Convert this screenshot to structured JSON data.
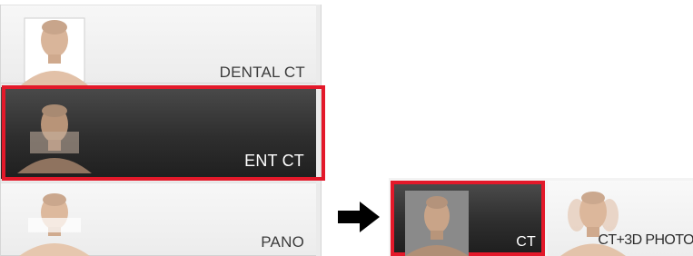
{
  "mode_list": {
    "items": [
      {
        "label": "DENTAL CT",
        "thumbnail_icon": "head-portrait-icon",
        "selected": false
      },
      {
        "label": "ENT CT",
        "thumbnail_icon": "head-portrait-icon",
        "selected": true
      },
      {
        "label": "PANO",
        "thumbnail_icon": "head-portrait-icon",
        "selected": false
      }
    ]
  },
  "transition_icon": "right-arrow-icon",
  "mode_bar": {
    "items": [
      {
        "label": "CT",
        "thumbnail_icon": "head-portrait-icon",
        "selected": true
      },
      {
        "label": "CT+3D PHOTO",
        "thumbnail_icon": "head-portrait-3d-icon",
        "selected": false
      }
    ]
  },
  "colors": {
    "selection": "#e3192a",
    "selected_background": "#2e2e2e",
    "unselected_background": "#f2f2f2",
    "selected_text": "#ffffff",
    "unselected_text": "#3c3c3c"
  }
}
